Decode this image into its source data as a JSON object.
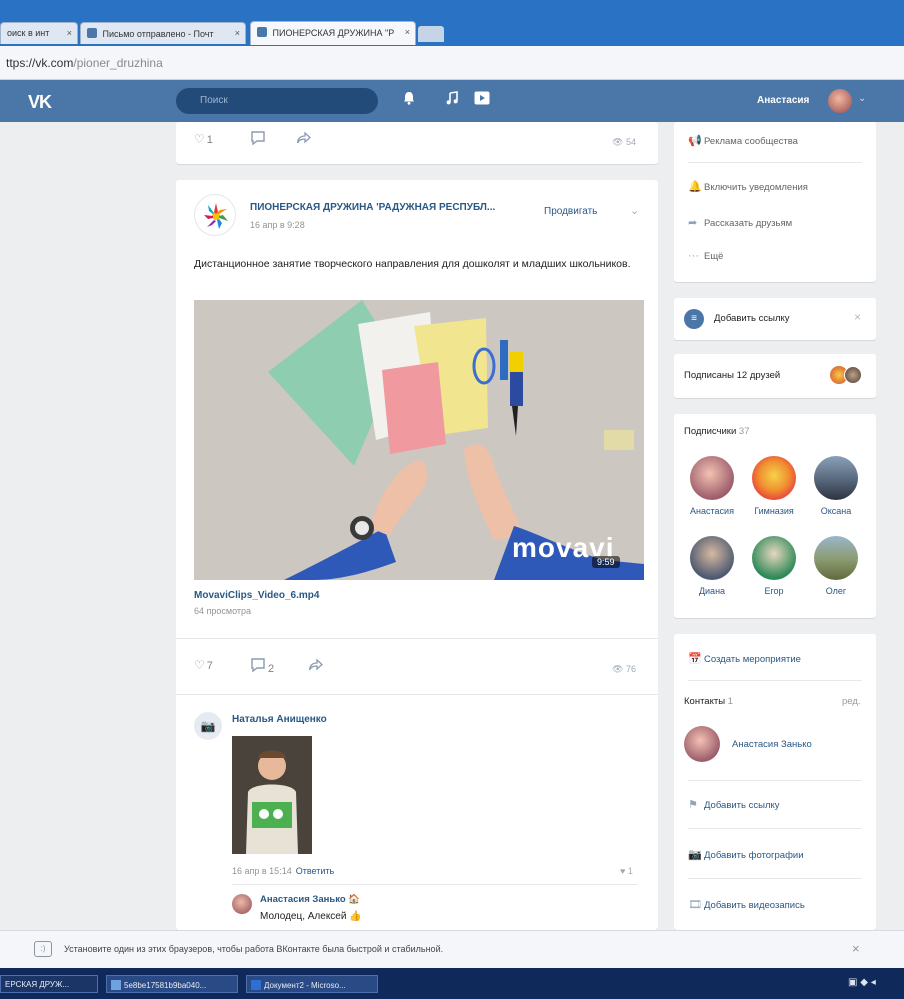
{
  "browser": {
    "tabs": [
      {
        "label": "оиск в инт",
        "close": "×"
      },
      {
        "label": "Письмо отправлено - Почт",
        "close": "×"
      },
      {
        "label": "ПИОНЕРСКАЯ ДРУЖИНА \"Р",
        "close": "×"
      }
    ],
    "url_host": "ttps://vk.com",
    "url_path": "/pioner_druzhina"
  },
  "header": {
    "logo": "VK",
    "search_placeholder": "Поиск",
    "user_name": "Анастасия"
  },
  "prev_post": {
    "likes": "1",
    "views": "54"
  },
  "post": {
    "author": "ПИОНЕРСКАЯ ДРУЖИНА 'РАДУЖНАЯ РЕСПУБЛ...",
    "date": "16 апр в 9:28",
    "promote": "Продвигать",
    "text": "Дистанционное занятие творческого направления для дошколят и младших школьников.",
    "video": {
      "watermark": "movavi",
      "duration": "9:59",
      "name": "MovaviClips_Video_6.mp4",
      "views": "64 просмотра"
    },
    "likes": "7",
    "comments": "2",
    "views": "76"
  },
  "comment": {
    "author": "Наталья Анищенко",
    "date": "16 апр в 15:14",
    "reply": "Ответить",
    "likes": "1",
    "reply_item": {
      "author": "Анастасия Занько",
      "text": "Молодец, Алексей"
    }
  },
  "sidebar": {
    "top": {
      "ads": "Реклама сообщества",
      "notify": "Включить уведомления",
      "tell": "Рассказать друзьям",
      "more": "Ещё"
    },
    "add_link": "Добавить ссылку",
    "friends_subscribed": "Подписаны 12 друзей",
    "subscribers": {
      "title": "Подписчики",
      "count": "37",
      "items": [
        {
          "name": "Анастасия"
        },
        {
          "name": "Гимназия"
        },
        {
          "name": "Оксана"
        },
        {
          "name": "Диана"
        },
        {
          "name": "Егор"
        },
        {
          "name": "Олег"
        }
      ]
    },
    "create_event": "Создать мероприятие",
    "contacts": {
      "title": "Контакты",
      "count": "1",
      "edit": "ред.",
      "person": "Анастасия Занько"
    },
    "actions": {
      "add_link": "Добавить ссылку",
      "add_photos": "Добавить фотографии",
      "add_video": "Добавить видеозапись"
    }
  },
  "notice": {
    "text": "Установите один из этих браузеров, чтобы работа ВКонтакте была быстрой и стабильной."
  },
  "taskbar": {
    "items": [
      {
        "label": "ЕРСКАЯ ДРУЖ..."
      },
      {
        "label": "5e8be17581b9ba040..."
      },
      {
        "label": "Документ2 - Microso..."
      }
    ]
  }
}
